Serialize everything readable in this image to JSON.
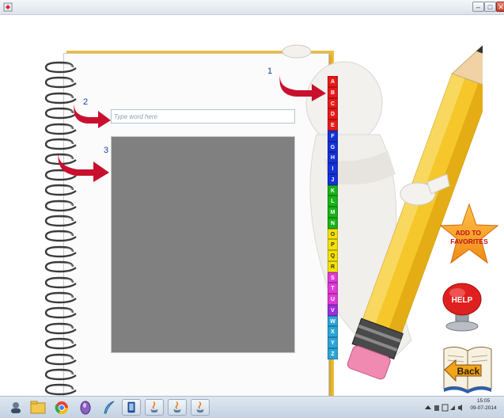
{
  "window": {
    "minimize_label": "–",
    "maximize_label": "□",
    "close_label": "✕"
  },
  "steps": {
    "one": "1",
    "two": "2",
    "three": "3"
  },
  "search": {
    "placeholder": "Type word here",
    "value": ""
  },
  "alphabet": {
    "letters": [
      "A",
      "B",
      "C",
      "D",
      "E",
      "F",
      "G",
      "H",
      "I",
      "J",
      "K",
      "L",
      "M",
      "N",
      "O",
      "P",
      "Q",
      "R",
      "S",
      "T",
      "U",
      "V",
      "W",
      "X",
      "Y",
      "Z"
    ],
    "colors": [
      "#e81919",
      "#e81919",
      "#e81919",
      "#e81919",
      "#e81919",
      "#1432d8",
      "#1432d8",
      "#1432d8",
      "#1432d8",
      "#1432d8",
      "#18b418",
      "#18b418",
      "#18b418",
      "#18b418",
      "#f4e200",
      "#f4e200",
      "#f4e200",
      "#f4e200",
      "#e03ad8",
      "#e03ad8",
      "#e03ad8",
      "#9b2fe0",
      "#2aa5d8",
      "#2aa5d8",
      "#2aa5d8",
      "#2aa5d8"
    ]
  },
  "buttons": {
    "favorites": "ADD TO FAVORITES",
    "help": "HELP",
    "back": "Back"
  },
  "taskbar": {
    "apps": [
      "user-icon",
      "file-manager-icon",
      "chrome-icon",
      "media-player-icon",
      "feather-icon",
      "tablet-app-icon",
      "java-app-icon",
      "java-app-icon",
      "java-app-icon"
    ]
  },
  "clock": {
    "time": "15:05",
    "date": "09-07-2014"
  },
  "colors": {
    "arrow": "#c8102e",
    "notebook_cover": "#efbe35",
    "results_bg": "#808080"
  }
}
